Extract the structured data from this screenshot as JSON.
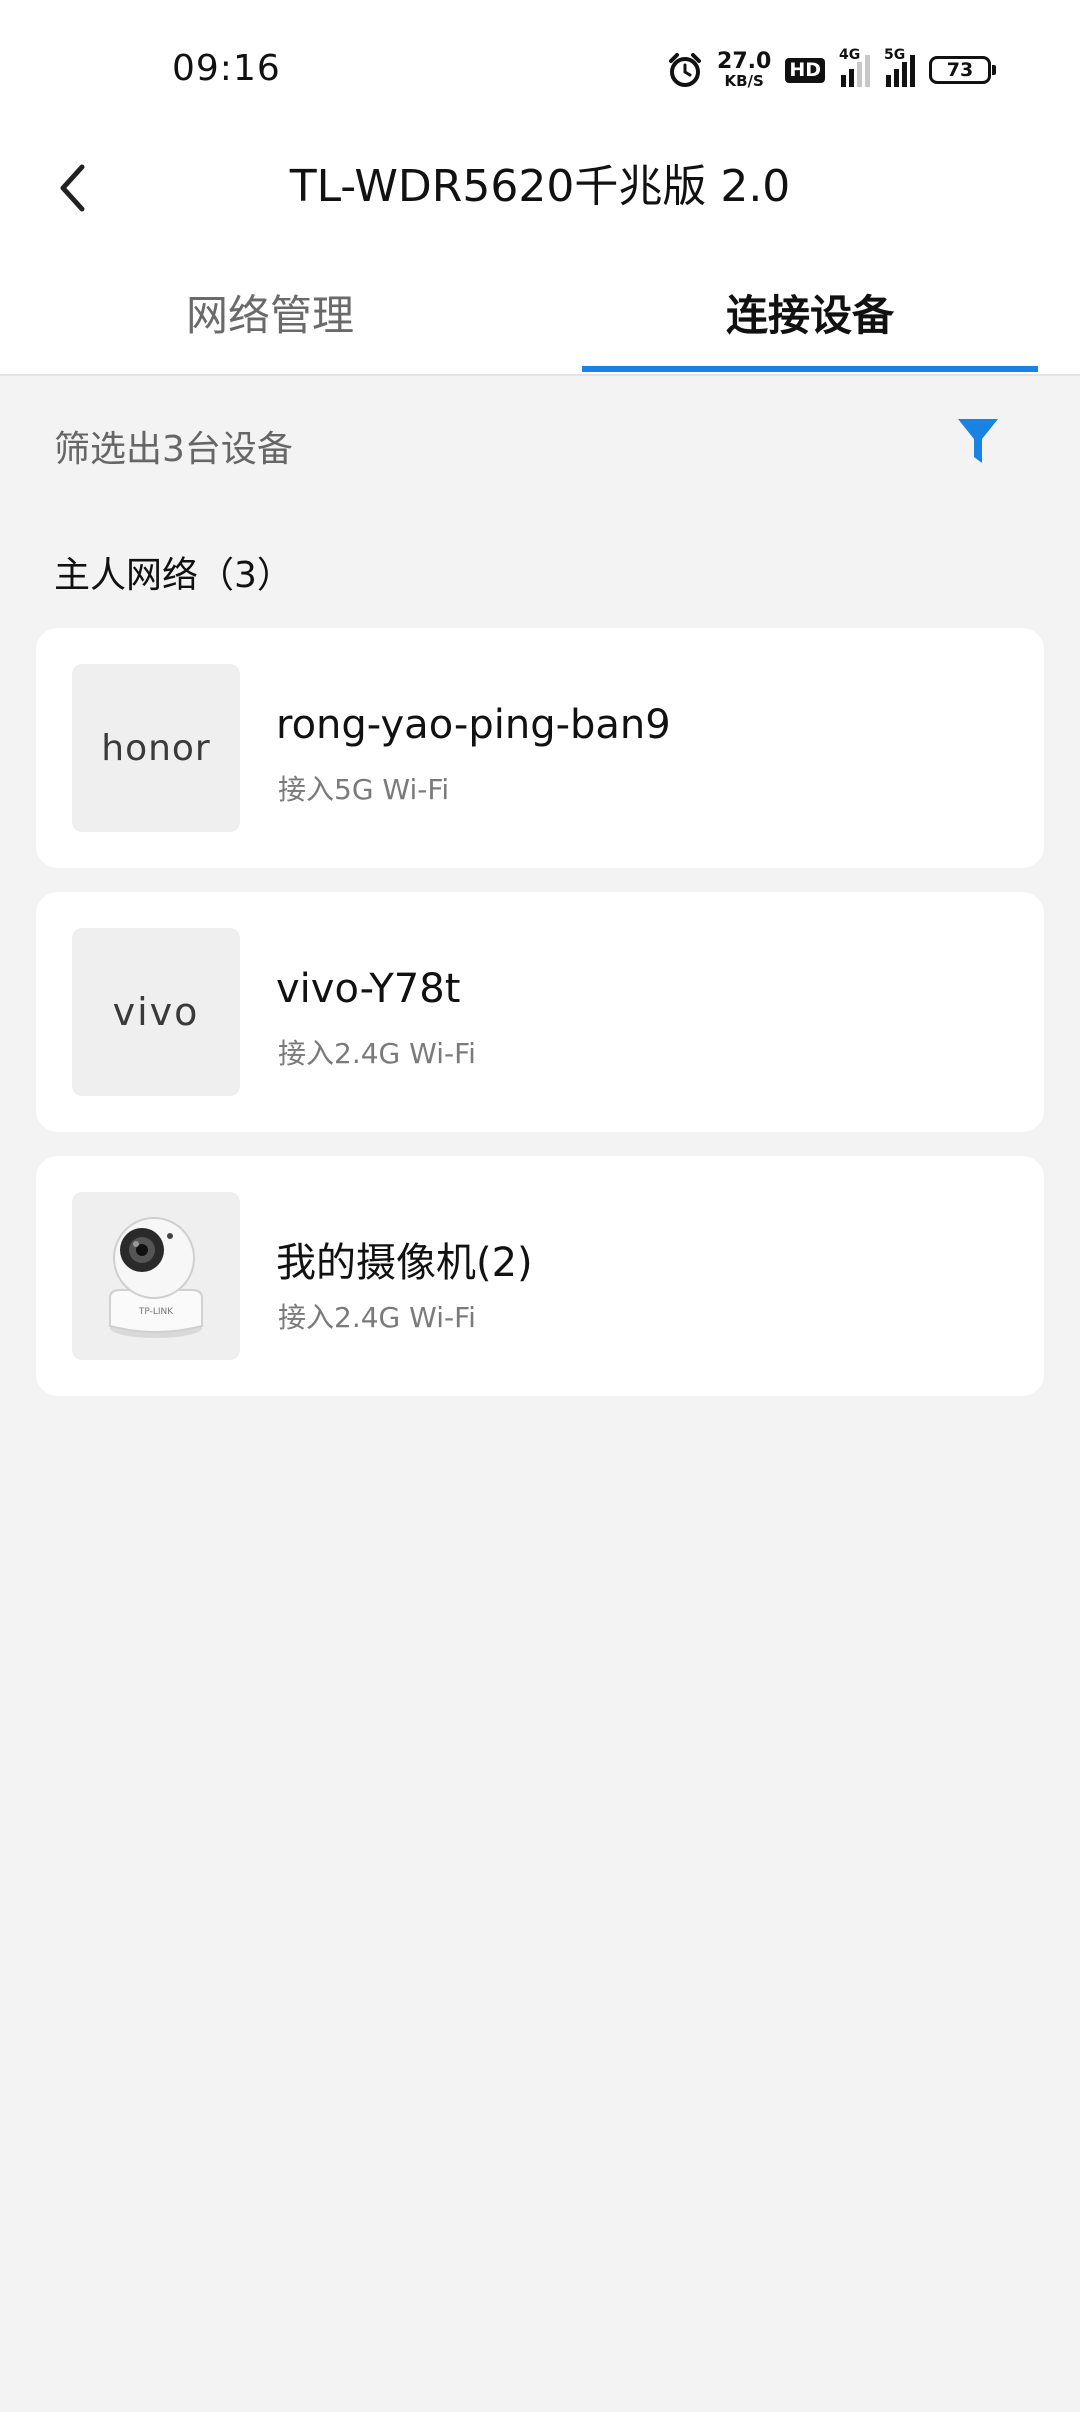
{
  "status_bar": {
    "time": "09:16",
    "net_speed_value": "27.0",
    "net_speed_unit": "KB/S",
    "hd_label": "HD",
    "sim1_label": "4G",
    "sim2_label": "5G",
    "battery_level": "73"
  },
  "header": {
    "title": "TL-WDR5620千兆版 2.0"
  },
  "tabs": [
    {
      "label": "网络管理",
      "active": false
    },
    {
      "label": "连接设备",
      "active": true
    }
  ],
  "filter": {
    "summary": "筛选出3台设备"
  },
  "section": {
    "title": "主人网络（3）"
  },
  "devices": [
    {
      "logo_text": "honor",
      "name": "rong-yao-ping-ban9",
      "connection": "接入5G Wi-Fi"
    },
    {
      "logo_text": "vivo",
      "name": "vivo-Y78t",
      "connection": "接入2.4G Wi-Fi"
    },
    {
      "logo_text": "TP-LINK",
      "name": "我的摄像机(2)",
      "connection": "接入2.4G Wi-Fi"
    }
  ],
  "colors": {
    "accent": "#1a82e2",
    "background": "#f3f3f3",
    "card": "#ffffff"
  }
}
